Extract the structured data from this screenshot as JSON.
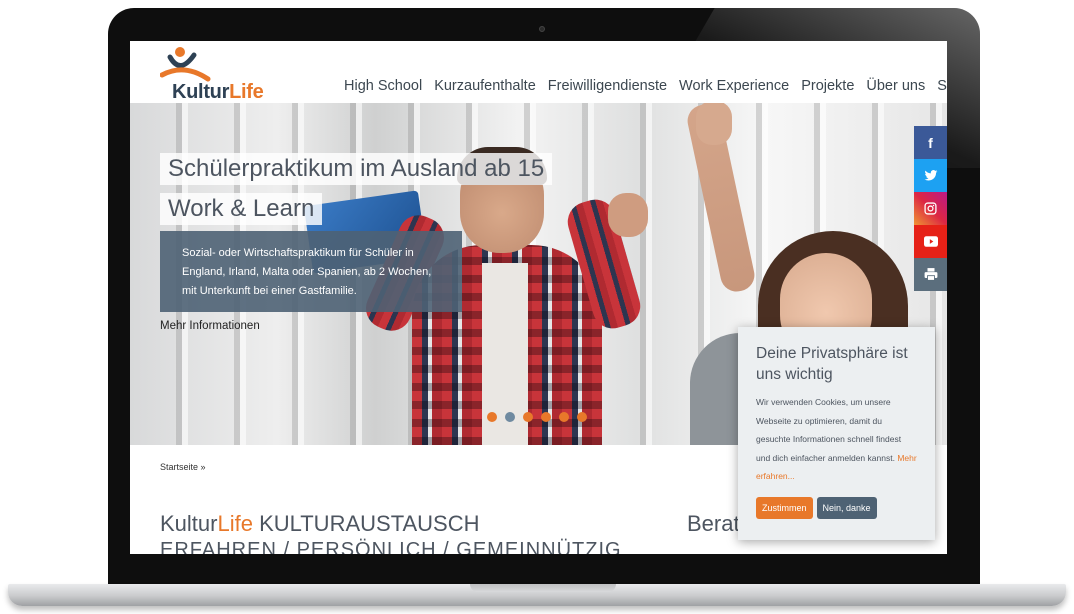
{
  "brand": {
    "name_part1": "Kultur",
    "name_part2": "Life"
  },
  "nav": {
    "items": [
      {
        "label": "High School"
      },
      {
        "label": "Kurzaufenthalte"
      },
      {
        "label": "Freiwilligendienste"
      },
      {
        "label": "Work Experience"
      },
      {
        "label": "Projekte"
      },
      {
        "label": "Über uns"
      },
      {
        "label": "Spenden"
      }
    ]
  },
  "hero": {
    "title": "Schülerpraktikum im Ausland ab 15",
    "subtitle": "Work & Learn",
    "description": "Sozial- oder Wirtschaftspraktikum für Schüler in England, Irland, Malta oder Spanien, ab 2 Wochen, mit Unterkunft bei einer Gastfamilie.",
    "link": "Mehr Informationen",
    "slides_total": 6,
    "active_slide": 2
  },
  "social": {
    "facebook": "f",
    "twitter": "twitter-icon",
    "instagram": "instagram-icon",
    "youtube": "youtube-icon",
    "print": "print-icon"
  },
  "breadcrumb": "Startseite »",
  "section": {
    "title_part1": "Kultur",
    "title_part2": "Life",
    "title_part3": " KULTURAUSTAUSCH",
    "subtitle": "ERFAHREN / PERSÖNLICH / GEMEINNÜTZIG",
    "side_title": "Beratu"
  },
  "cookie": {
    "title": "Deine Privatsphäre ist uns wichtig",
    "text": "Wir verwenden Cookies, um unsere Webseite zu optimieren, damit du gesuchte Informationen schnell findest und dich einfacher anmelden kannst.",
    "more": "Mehr erfahren...",
    "accept": "Zustimmen",
    "decline": "Nein, danke"
  },
  "colors": {
    "accent": "#e8782a",
    "navy": "#2e4154",
    "slate": "#4e6274"
  }
}
